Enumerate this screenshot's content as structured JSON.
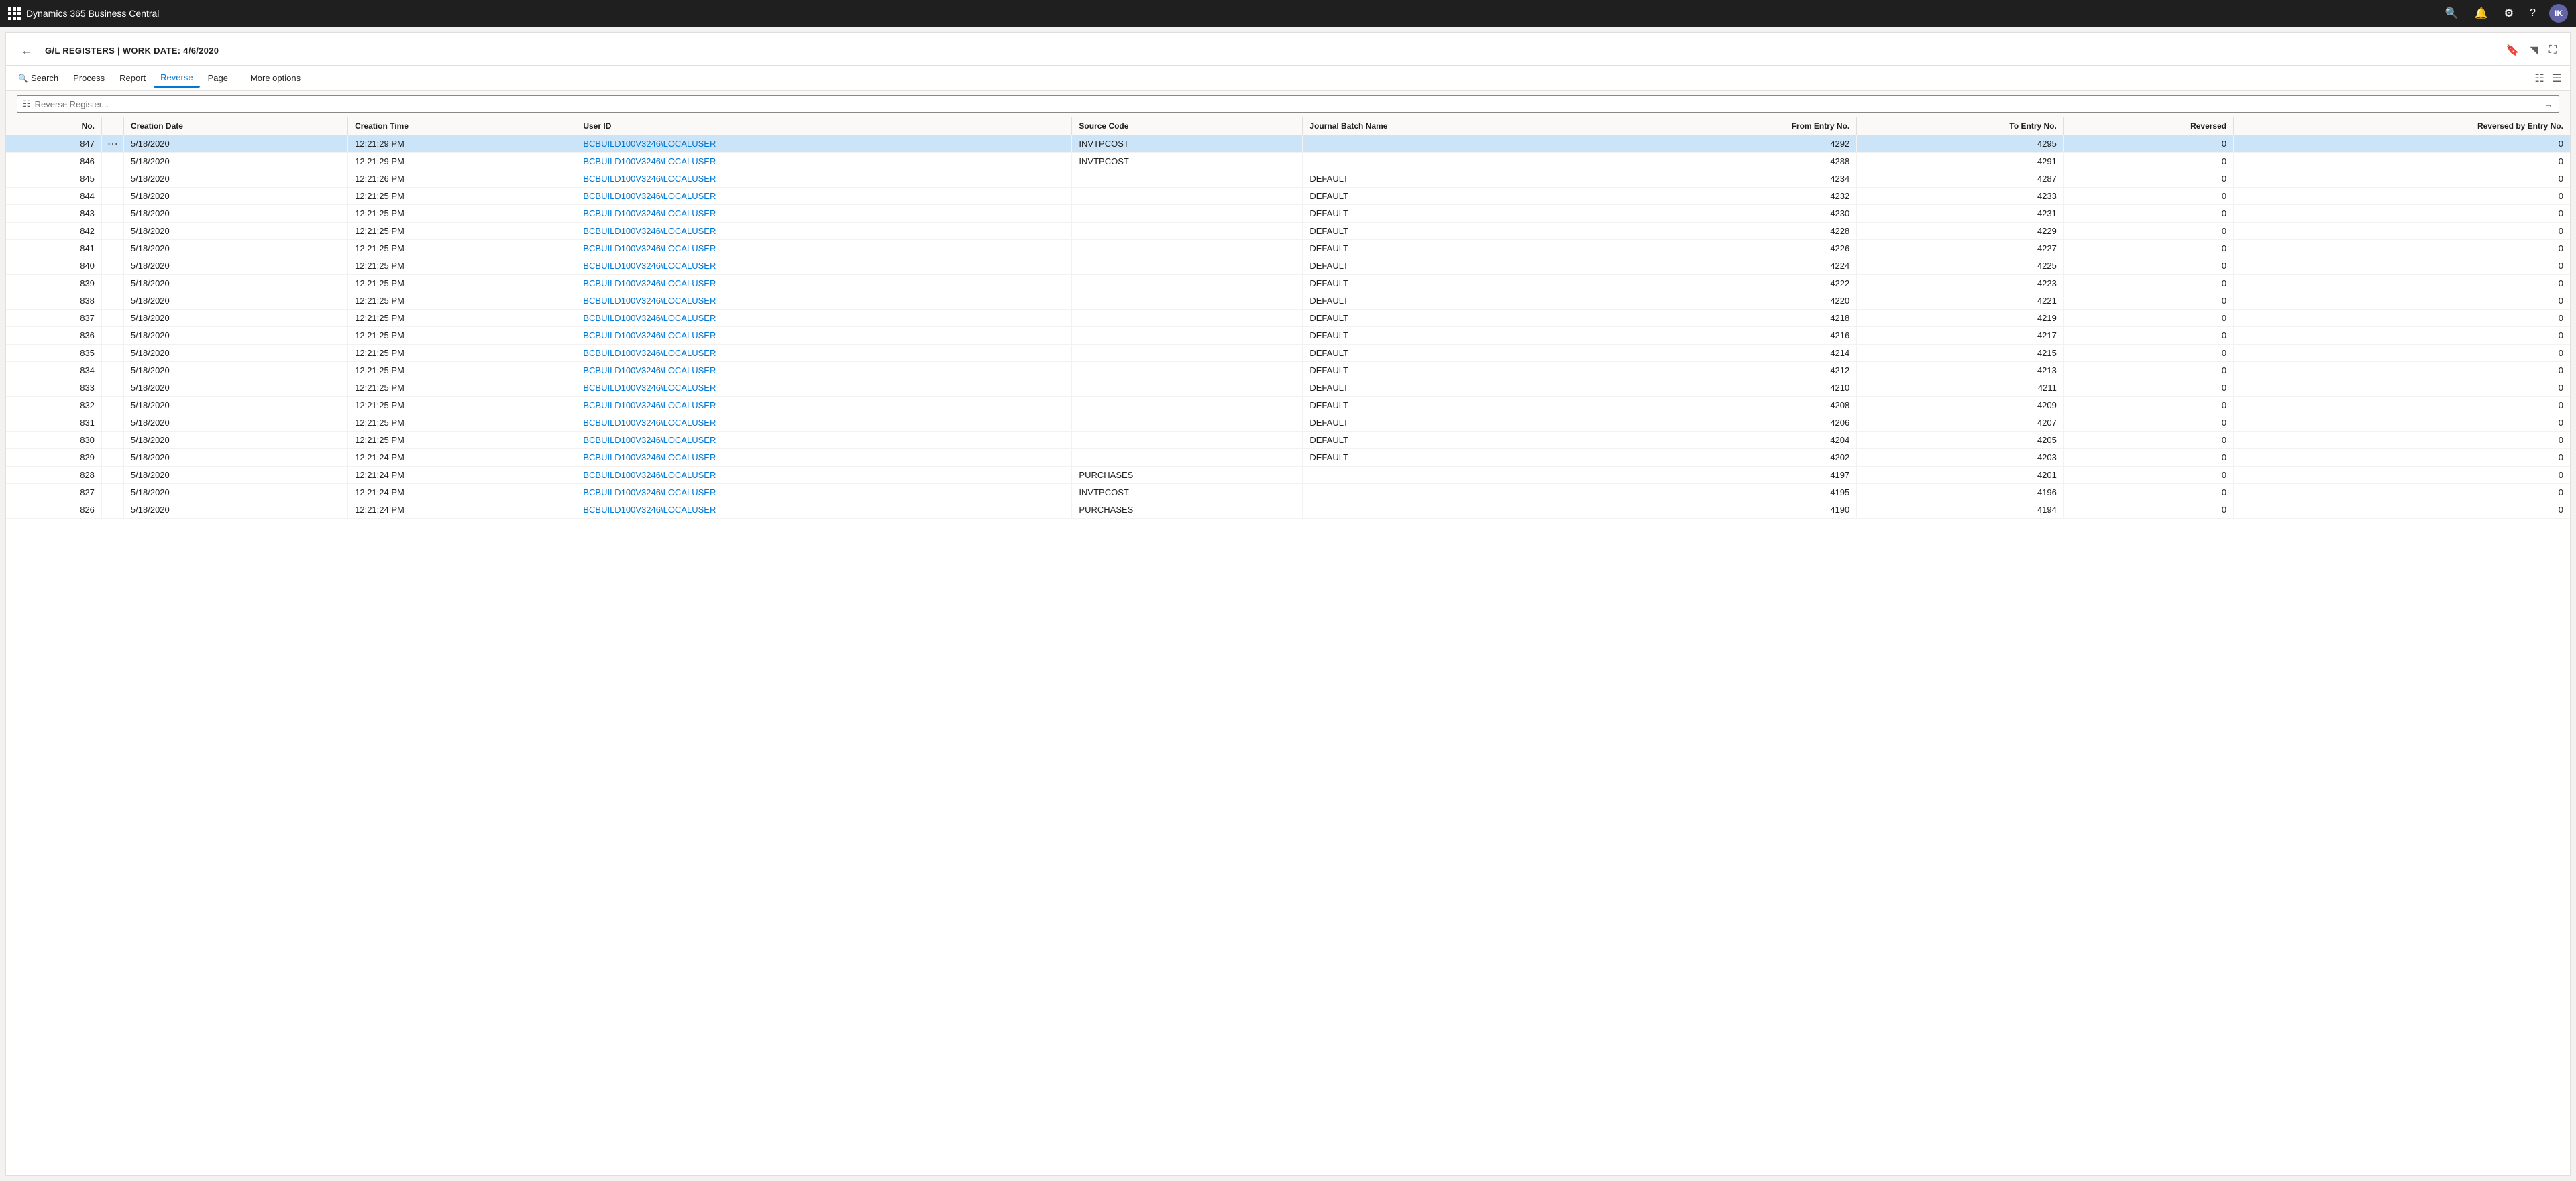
{
  "app": {
    "title": "Dynamics 365 Business Central",
    "nav_icons": [
      "search",
      "bell",
      "settings",
      "help"
    ],
    "avatar_initials": "IK"
  },
  "page": {
    "title": "G/L REGISTERS | WORK DATE: 4/6/2020",
    "back_label": "←"
  },
  "toolbar": {
    "items": [
      {
        "label": "Search",
        "key": "search"
      },
      {
        "label": "Process",
        "key": "process"
      },
      {
        "label": "Report",
        "key": "report"
      },
      {
        "label": "Reverse",
        "key": "reverse",
        "active": true
      },
      {
        "label": "Page",
        "key": "page"
      },
      {
        "label": "More options",
        "key": "more"
      }
    ]
  },
  "search_bar": {
    "placeholder": "Reverse Register..."
  },
  "table": {
    "columns": [
      {
        "key": "no",
        "label": "No.",
        "align": "right"
      },
      {
        "key": "more",
        "label": "",
        "align": "center"
      },
      {
        "key": "creation_date",
        "label": "Creation Date",
        "align": "left"
      },
      {
        "key": "creation_time",
        "label": "Creation Time",
        "align": "left"
      },
      {
        "key": "user_id",
        "label": "User ID",
        "align": "left"
      },
      {
        "key": "source_code",
        "label": "Source Code",
        "align": "left"
      },
      {
        "key": "journal_batch_name",
        "label": "Journal Batch Name",
        "align": "left"
      },
      {
        "key": "from_entry_no",
        "label": "From Entry No.",
        "align": "right"
      },
      {
        "key": "to_entry_no",
        "label": "To Entry No.",
        "align": "right"
      },
      {
        "key": "reversed",
        "label": "Reversed",
        "align": "right"
      },
      {
        "key": "reversed_by",
        "label": "Reversed by Entry No.",
        "align": "right"
      }
    ],
    "header_row": {
      "no": "",
      "creation_date": "",
      "creation_time": "",
      "user_id": "",
      "source_code": "",
      "journal_batch_name": "",
      "from_entry_no": "",
      "to_entry_no": "",
      "reversed": "",
      "reversed_by": ""
    },
    "rows": [
      {
        "no": "847",
        "more": true,
        "creation_date": "5/18/2020",
        "creation_time": "12:21:29 PM",
        "user_id": "BCBUILD100V3246\\LOCALUSER",
        "source_code": "INVTPCOST",
        "journal_batch_name": "",
        "from_entry_no": "4292",
        "to_entry_no": "4295",
        "reversed": "0",
        "reversed_by": "0",
        "selected": true
      },
      {
        "no": "846",
        "more": false,
        "creation_date": "5/18/2020",
        "creation_time": "12:21:29 PM",
        "user_id": "BCBUILD100V3246\\LOCALUSER",
        "source_code": "INVTPCOST",
        "journal_batch_name": "",
        "from_entry_no": "4288",
        "to_entry_no": "4291",
        "reversed": "0",
        "reversed_by": "0"
      },
      {
        "no": "845",
        "more": false,
        "creation_date": "5/18/2020",
        "creation_time": "12:21:26 PM",
        "user_id": "BCBUILD100V3246\\LOCALUSER",
        "source_code": "",
        "journal_batch_name": "DEFAULT",
        "from_entry_no": "4234",
        "to_entry_no": "4287",
        "reversed": "0",
        "reversed_by": "0"
      },
      {
        "no": "844",
        "more": false,
        "creation_date": "5/18/2020",
        "creation_time": "12:21:25 PM",
        "user_id": "BCBUILD100V3246\\LOCALUSER",
        "source_code": "",
        "journal_batch_name": "DEFAULT",
        "from_entry_no": "4232",
        "to_entry_no": "4233",
        "reversed": "0",
        "reversed_by": "0"
      },
      {
        "no": "843",
        "more": false,
        "creation_date": "5/18/2020",
        "creation_time": "12:21:25 PM",
        "user_id": "BCBUILD100V3246\\LOCALUSER",
        "source_code": "",
        "journal_batch_name": "DEFAULT",
        "from_entry_no": "4230",
        "to_entry_no": "4231",
        "reversed": "0",
        "reversed_by": "0"
      },
      {
        "no": "842",
        "more": false,
        "creation_date": "5/18/2020",
        "creation_time": "12:21:25 PM",
        "user_id": "BCBUILD100V3246\\LOCALUSER",
        "source_code": "",
        "journal_batch_name": "DEFAULT",
        "from_entry_no": "4228",
        "to_entry_no": "4229",
        "reversed": "0",
        "reversed_by": "0"
      },
      {
        "no": "841",
        "more": false,
        "creation_date": "5/18/2020",
        "creation_time": "12:21:25 PM",
        "user_id": "BCBUILD100V3246\\LOCALUSER",
        "source_code": "",
        "journal_batch_name": "DEFAULT",
        "from_entry_no": "4226",
        "to_entry_no": "4227",
        "reversed": "0",
        "reversed_by": "0"
      },
      {
        "no": "840",
        "more": false,
        "creation_date": "5/18/2020",
        "creation_time": "12:21:25 PM",
        "user_id": "BCBUILD100V3246\\LOCALUSER",
        "source_code": "",
        "journal_batch_name": "DEFAULT",
        "from_entry_no": "4224",
        "to_entry_no": "4225",
        "reversed": "0",
        "reversed_by": "0"
      },
      {
        "no": "839",
        "more": false,
        "creation_date": "5/18/2020",
        "creation_time": "12:21:25 PM",
        "user_id": "BCBUILD100V3246\\LOCALUSER",
        "source_code": "",
        "journal_batch_name": "DEFAULT",
        "from_entry_no": "4222",
        "to_entry_no": "4223",
        "reversed": "0",
        "reversed_by": "0"
      },
      {
        "no": "838",
        "more": false,
        "creation_date": "5/18/2020",
        "creation_time": "12:21:25 PM",
        "user_id": "BCBUILD100V3246\\LOCALUSER",
        "source_code": "",
        "journal_batch_name": "DEFAULT",
        "from_entry_no": "4220",
        "to_entry_no": "4221",
        "reversed": "0",
        "reversed_by": "0"
      },
      {
        "no": "837",
        "more": false,
        "creation_date": "5/18/2020",
        "creation_time": "12:21:25 PM",
        "user_id": "BCBUILD100V3246\\LOCALUSER",
        "source_code": "",
        "journal_batch_name": "DEFAULT",
        "from_entry_no": "4218",
        "to_entry_no": "4219",
        "reversed": "0",
        "reversed_by": "0"
      },
      {
        "no": "836",
        "more": false,
        "creation_date": "5/18/2020",
        "creation_time": "12:21:25 PM",
        "user_id": "BCBUILD100V3246\\LOCALUSER",
        "source_code": "",
        "journal_batch_name": "DEFAULT",
        "from_entry_no": "4216",
        "to_entry_no": "4217",
        "reversed": "0",
        "reversed_by": "0"
      },
      {
        "no": "835",
        "more": false,
        "creation_date": "5/18/2020",
        "creation_time": "12:21:25 PM",
        "user_id": "BCBUILD100V3246\\LOCALUSER",
        "source_code": "",
        "journal_batch_name": "DEFAULT",
        "from_entry_no": "4214",
        "to_entry_no": "4215",
        "reversed": "0",
        "reversed_by": "0"
      },
      {
        "no": "834",
        "more": false,
        "creation_date": "5/18/2020",
        "creation_time": "12:21:25 PM",
        "user_id": "BCBUILD100V3246\\LOCALUSER",
        "source_code": "",
        "journal_batch_name": "DEFAULT",
        "from_entry_no": "4212",
        "to_entry_no": "4213",
        "reversed": "0",
        "reversed_by": "0"
      },
      {
        "no": "833",
        "more": false,
        "creation_date": "5/18/2020",
        "creation_time": "12:21:25 PM",
        "user_id": "BCBUILD100V3246\\LOCALUSER",
        "source_code": "",
        "journal_batch_name": "DEFAULT",
        "from_entry_no": "4210",
        "to_entry_no": "4211",
        "reversed": "0",
        "reversed_by": "0"
      },
      {
        "no": "832",
        "more": false,
        "creation_date": "5/18/2020",
        "creation_time": "12:21:25 PM",
        "user_id": "BCBUILD100V3246\\LOCALUSER",
        "source_code": "",
        "journal_batch_name": "DEFAULT",
        "from_entry_no": "4208",
        "to_entry_no": "4209",
        "reversed": "0",
        "reversed_by": "0"
      },
      {
        "no": "831",
        "more": false,
        "creation_date": "5/18/2020",
        "creation_time": "12:21:25 PM",
        "user_id": "BCBUILD100V3246\\LOCALUSER",
        "source_code": "",
        "journal_batch_name": "DEFAULT",
        "from_entry_no": "4206",
        "to_entry_no": "4207",
        "reversed": "0",
        "reversed_by": "0"
      },
      {
        "no": "830",
        "more": false,
        "creation_date": "5/18/2020",
        "creation_time": "12:21:25 PM",
        "user_id": "BCBUILD100V3246\\LOCALUSER",
        "source_code": "",
        "journal_batch_name": "DEFAULT",
        "from_entry_no": "4204",
        "to_entry_no": "4205",
        "reversed": "0",
        "reversed_by": "0"
      },
      {
        "no": "829",
        "more": false,
        "creation_date": "5/18/2020",
        "creation_time": "12:21:24 PM",
        "user_id": "BCBUILD100V3246\\LOCALUSER",
        "source_code": "",
        "journal_batch_name": "DEFAULT",
        "from_entry_no": "4202",
        "to_entry_no": "4203",
        "reversed": "0",
        "reversed_by": "0"
      },
      {
        "no": "828",
        "more": false,
        "creation_date": "5/18/2020",
        "creation_time": "12:21:24 PM",
        "user_id": "BCBUILD100V3246\\LOCALUSER",
        "source_code": "PURCHASES",
        "journal_batch_name": "",
        "from_entry_no": "4197",
        "to_entry_no": "4201",
        "reversed": "0",
        "reversed_by": "0"
      },
      {
        "no": "827",
        "more": false,
        "creation_date": "5/18/2020",
        "creation_time": "12:21:24 PM",
        "user_id": "BCBUILD100V3246\\LOCALUSER",
        "source_code": "INVTPCOST",
        "journal_batch_name": "",
        "from_entry_no": "4195",
        "to_entry_no": "4196",
        "reversed": "0",
        "reversed_by": "0"
      },
      {
        "no": "826",
        "more": false,
        "creation_date": "5/18/2020",
        "creation_time": "12:21:24 PM",
        "user_id": "BCBUILD100V3246\\LOCALUSER",
        "source_code": "PURCHASES",
        "journal_batch_name": "",
        "from_entry_no": "4190",
        "to_entry_no": "4194",
        "reversed": "0",
        "reversed_by": "0"
      }
    ]
  }
}
